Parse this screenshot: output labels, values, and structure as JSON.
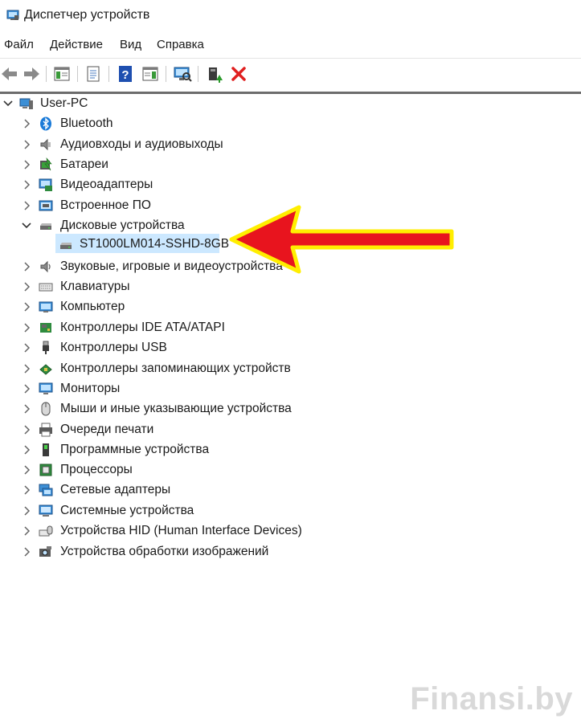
{
  "window": {
    "title": "Диспетчер устройств"
  },
  "menu": [
    "Файл",
    "Действие",
    "Вид",
    "Справка"
  ],
  "toolbar": {
    "buttons": [
      "back-icon",
      "forward-icon",
      "console-tree-icon",
      "properties-icon",
      "help-icon",
      "action-pane-icon",
      "scan-hardware-icon",
      "update-driver-icon",
      "uninstall-icon"
    ],
    "accent": "#1e6fd0",
    "danger": "#e02020"
  },
  "tree": {
    "root": "User-PC",
    "categories": [
      {
        "label": "Bluetooth",
        "icon": "bluetooth-icon"
      },
      {
        "label": "Аудиовходы и аудиовыходы",
        "icon": "audio-io-icon"
      },
      {
        "label": "Батареи",
        "icon": "battery-icon"
      },
      {
        "label": "Видеоадаптеры",
        "icon": "display-adapter-icon"
      },
      {
        "label": "Встроенное ПО",
        "icon": "firmware-icon"
      },
      {
        "label": "Дисковые устройства",
        "icon": "disk-drive-icon",
        "expanded": true,
        "children": [
          {
            "label": "ST1000LM014-SSHD-8GB",
            "icon": "disk-drive-icon",
            "selected": true
          }
        ]
      },
      {
        "label": "Звуковые, игровые и видеоустройства",
        "icon": "sound-icon"
      },
      {
        "label": "Клавиатуры",
        "icon": "keyboard-icon"
      },
      {
        "label": "Компьютер",
        "icon": "computer-icon"
      },
      {
        "label": "Контроллеры IDE ATA/ATAPI",
        "icon": "ide-controller-icon"
      },
      {
        "label": "Контроллеры USB",
        "icon": "usb-icon"
      },
      {
        "label": "Контроллеры запоминающих устройств",
        "icon": "storage-controller-icon"
      },
      {
        "label": "Мониторы",
        "icon": "monitor-icon"
      },
      {
        "label": "Мыши и иные указывающие устройства",
        "icon": "mouse-icon"
      },
      {
        "label": "Очереди печати",
        "icon": "printer-icon"
      },
      {
        "label": "Программные устройства",
        "icon": "software-device-icon"
      },
      {
        "label": "Процессоры",
        "icon": "processor-icon"
      },
      {
        "label": "Сетевые адаптеры",
        "icon": "network-adapter-icon"
      },
      {
        "label": "Системные устройства",
        "icon": "system-device-icon"
      },
      {
        "label": "Устройства HID (Human Interface Devices)",
        "icon": "hid-icon"
      },
      {
        "label": "Устройства обработки изображений",
        "icon": "imaging-icon"
      }
    ]
  },
  "selection_color": "#cce8ff",
  "annotation": {
    "arrow_fill": "#e8141e",
    "arrow_outline": "#ffee00"
  },
  "watermark": "Finansi.by"
}
